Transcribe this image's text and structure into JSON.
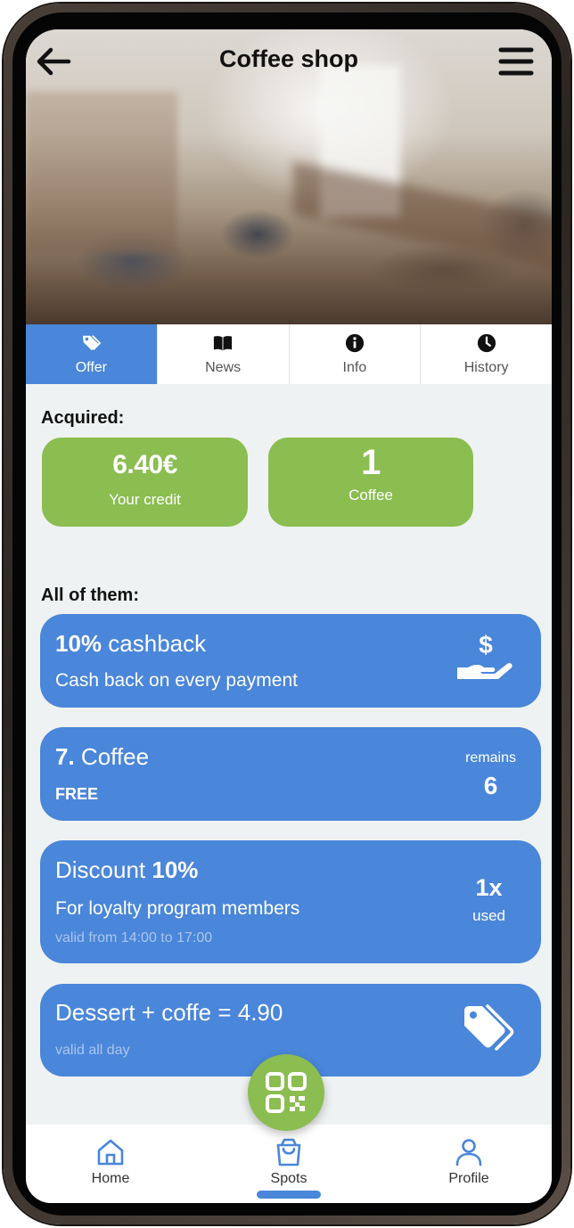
{
  "header": {
    "title": "Coffee shop"
  },
  "tabs": [
    {
      "label": "Offer",
      "icon": "tag-icon",
      "active": true
    },
    {
      "label": "News",
      "icon": "book-icon"
    },
    {
      "label": "Info",
      "icon": "info-icon"
    },
    {
      "label": "History",
      "icon": "clock-icon"
    }
  ],
  "acquired": {
    "label": "Acquired:",
    "cards": [
      {
        "value": "6.40€",
        "label": "Your credit"
      },
      {
        "value": "1",
        "label": "Coffee"
      }
    ]
  },
  "all": {
    "label": "All of them:",
    "offers": [
      {
        "title_bold": "10%",
        "title_rest": " cashback",
        "desc": "Cash back on every payment",
        "icon": "cash-hand-icon"
      },
      {
        "title_bold": "7.",
        "title_rest": " Coffee",
        "desc": "FREE",
        "right_top": "remains",
        "right_value": "6"
      },
      {
        "title_rest": "Discount ",
        "title_bold": "10%",
        "desc": "For loyalty program members",
        "valid": "valid from 14:00 to 17:00",
        "right_value": "1x",
        "right_bottom": "used"
      },
      {
        "title_rest": "Dessert + coffe = 4.90",
        "valid": "valid all day",
        "icon": "tags-icon"
      }
    ]
  },
  "bottom_nav": {
    "items": [
      {
        "label": "Home",
        "icon": "home-icon"
      },
      {
        "label": "Spots",
        "icon": "bag-icon",
        "active": true
      },
      {
        "label": "Profile",
        "icon": "user-icon"
      }
    ],
    "fab_icon": "qr-code-icon"
  },
  "colors": {
    "accent_blue": "#4a86d9",
    "accent_green": "#8bbd50"
  }
}
